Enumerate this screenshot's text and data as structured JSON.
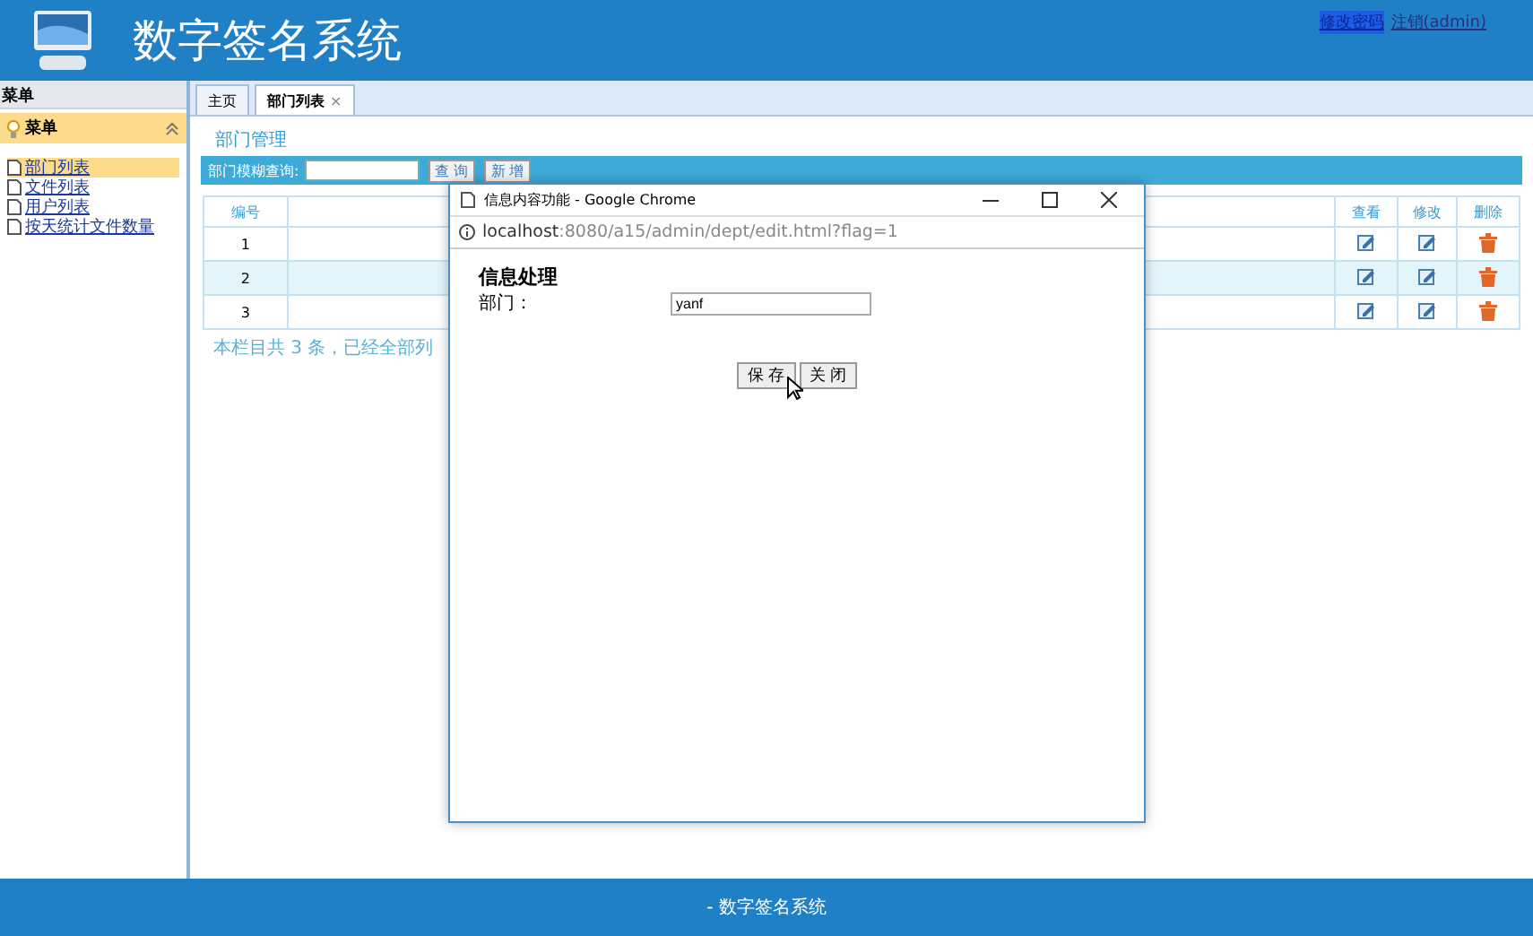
{
  "header": {
    "title": "数字签名系统",
    "links": [
      {
        "label": "修改密码",
        "selected": true
      },
      {
        "label": "注销(admin)",
        "selected": false
      }
    ]
  },
  "sidebar": {
    "title": "菜单",
    "section": {
      "label": "菜单",
      "expanded": true,
      "items": [
        {
          "label": "部门列表",
          "selected": true
        },
        {
          "label": "文件列表",
          "selected": false
        },
        {
          "label": "用户列表",
          "selected": false
        },
        {
          "label": "按天统计文件数量",
          "selected": false
        }
      ]
    }
  },
  "tabs": [
    {
      "label": "主页",
      "selected": false
    },
    {
      "label": "部门列表",
      "selected": true,
      "close": "×"
    }
  ],
  "page": {
    "title": "部门管理",
    "search_label": "部门模糊查询:",
    "buttons": [
      "查 询",
      "新 增"
    ]
  },
  "table": {
    "columns": [
      "编号",
      "",
      "查看",
      "修改",
      "删除"
    ],
    "rows": [
      {
        "id": "1",
        "selected": false
      },
      {
        "id": "2",
        "selected": true
      },
      {
        "id": "3",
        "selected": false
      }
    ],
    "summary": "本栏目共 3 条，已经全部列"
  },
  "popup": {
    "title": "信息内容功能 - Google Chrome",
    "url_host": "localhost",
    "url_path": ":8080/a15/admin/dept/edit.html?flag=1",
    "heading": "信息处理",
    "field_label": "部门：",
    "field_value": "yanf",
    "buttons": [
      "保 存",
      "关 闭"
    ]
  },
  "footer": "- 数字签名系统"
}
